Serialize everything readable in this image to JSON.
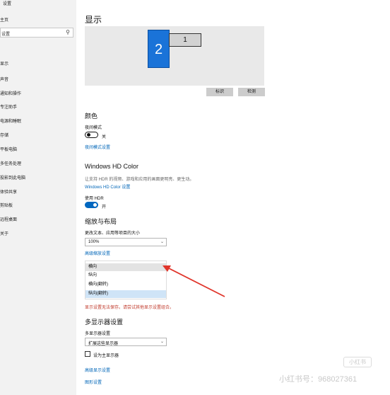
{
  "window": {
    "title": "设置"
  },
  "sidebar": {
    "home": "主页",
    "search_placeholder": "设置",
    "search_icon": "search-icon",
    "items": [
      {
        "label": "显示"
      },
      {
        "label": "声音"
      },
      {
        "label": "通知和操作"
      },
      {
        "label": "专注助手"
      },
      {
        "label": "电源和睡眠"
      },
      {
        "label": "存储"
      },
      {
        "label": "平板电脑"
      },
      {
        "label": "多任务处理"
      },
      {
        "label": "投影到此电脑"
      },
      {
        "label": "体验共享"
      },
      {
        "label": "剪贴板"
      },
      {
        "label": "远程桌面"
      },
      {
        "label": "关于"
      }
    ]
  },
  "main": {
    "title": "显示",
    "monitors": {
      "primary": "2",
      "secondary": "1"
    },
    "identify_button": "标识",
    "detect_button": "检测",
    "color": {
      "heading": "颜色",
      "night_light_label": "夜间模式",
      "night_light_state": "关",
      "night_light_settings_link": "夜间模式设置"
    },
    "hdr": {
      "heading": "Windows HD Color",
      "description": "让支持 HDR 的视频、游戏和应用的画面更明亮、更生动。",
      "settings_link": "Windows HD Color 设置",
      "use_hdr_label": "使用 HDR",
      "use_hdr_state": "开"
    },
    "scale": {
      "heading": "缩放与布局",
      "text_size_label": "更改文本、应用等项目的大小",
      "text_size_value": "100%",
      "advanced_link": "高级缩放设置"
    },
    "orientation_dropdown": {
      "options": [
        "横向",
        "纵向",
        "横向(翻转)",
        "纵向(翻转)"
      ]
    },
    "error_text": "显示设置无法保存。请尝试其他显示设置组合。",
    "multi": {
      "heading": "多显示器设置",
      "label": "多显示器设置",
      "value": "扩展这些显示器",
      "make_main_label": "设为主显示器",
      "advanced_link": "高级显示设置",
      "graphics_link": "图形设置"
    }
  },
  "watermark": {
    "badge": "小红书",
    "text": "小红书号：968027361"
  },
  "colors": {
    "accent": "#0067c0",
    "monitor_primary": "#1a73d8",
    "link": "#0066b8",
    "error": "#c0392b",
    "arrow": "#e0352b"
  }
}
